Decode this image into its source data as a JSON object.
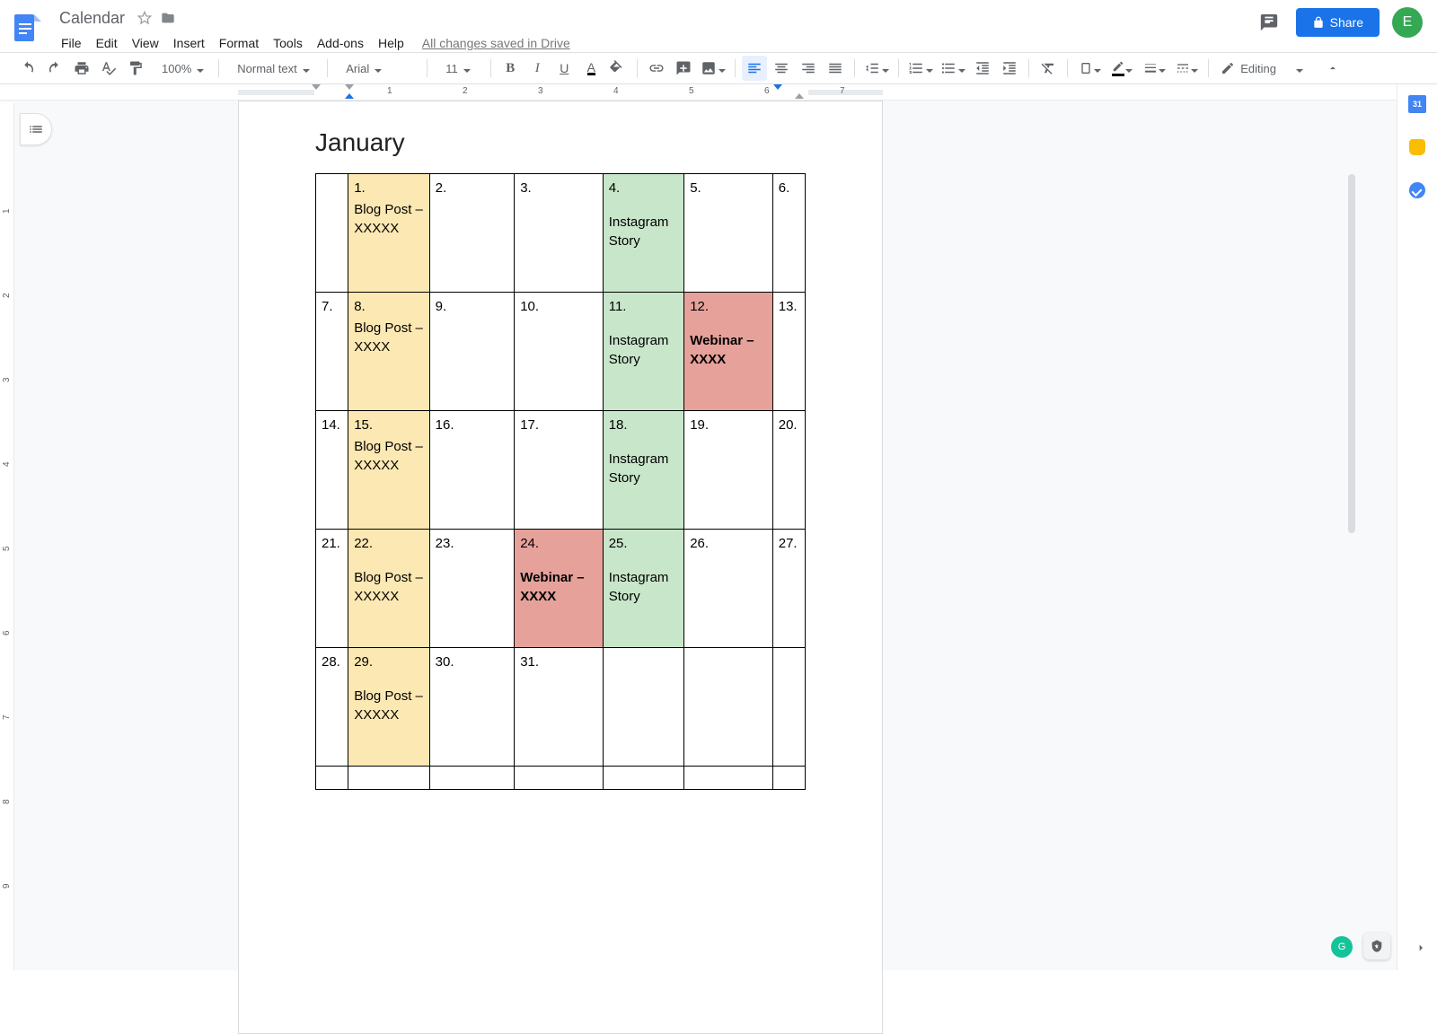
{
  "doc": {
    "title": "Calendar",
    "save_status": "All changes saved in Drive"
  },
  "avatar": {
    "initial": "E"
  },
  "menu": [
    "File",
    "Edit",
    "View",
    "Insert",
    "Format",
    "Tools",
    "Add-ons",
    "Help"
  ],
  "toolbar": {
    "zoom": "100%",
    "style": "Normal text",
    "font": "Arial",
    "size": "11",
    "mode": "Editing"
  },
  "share": {
    "label": "Share"
  },
  "side_calendar_day": "31",
  "hruler_ticks": [
    "1",
    "2",
    "3",
    "4",
    "5",
    "6",
    "7"
  ],
  "document": {
    "heading": "January",
    "rows": [
      [
        {
          "num": "",
          "body": "",
          "bg": ""
        },
        {
          "num": "1.",
          "body": "Blog Post  – XXXXX",
          "bg": "yellow"
        },
        {
          "num": "2.",
          "body": "",
          "bg": ""
        },
        {
          "num": "3.",
          "body": "",
          "bg": ""
        },
        {
          "num": "4.",
          "body": "Instagram Story",
          "bg": "green",
          "gap": true
        },
        {
          "num": "5.",
          "body": "",
          "bg": ""
        },
        {
          "num": "6.",
          "body": "",
          "bg": ""
        }
      ],
      [
        {
          "num": "7.",
          "body": "",
          "bg": ""
        },
        {
          "num": "8.",
          "body": "Blog Post – XXXX",
          "bg": "yellow"
        },
        {
          "num": "9.",
          "body": "",
          "bg": ""
        },
        {
          "num": "10.",
          "body": "",
          "bg": ""
        },
        {
          "num": "11.",
          "body": "Instagram Story",
          "bg": "green",
          "gap": true
        },
        {
          "num": "12.",
          "body": "Webinar – XXXX",
          "bg": "red",
          "gap": true,
          "bold": true
        },
        {
          "num": "13.",
          "body": "",
          "bg": ""
        }
      ],
      [
        {
          "num": "14.",
          "body": "",
          "bg": ""
        },
        {
          "num": "15.",
          "body": "Blog Post  – XXXXX",
          "bg": "yellow"
        },
        {
          "num": "16.",
          "body": "",
          "bg": ""
        },
        {
          "num": "17.",
          "body": "",
          "bg": ""
        },
        {
          "num": "18.",
          "body": "Instagram Story",
          "bg": "green",
          "gap": true
        },
        {
          "num": "19.",
          "body": "",
          "bg": ""
        },
        {
          "num": "20.",
          "body": "",
          "bg": ""
        }
      ],
      [
        {
          "num": "21.",
          "body": "",
          "bg": ""
        },
        {
          "num": "22.",
          "body": "Blog Post  – XXXXX",
          "bg": "yellow",
          "gap": true
        },
        {
          "num": "23.",
          "body": "",
          "bg": ""
        },
        {
          "num": "24.",
          "body": "Webinar – XXXX",
          "bg": "red",
          "gap": true,
          "bold": true
        },
        {
          "num": "25.",
          "body": "Instagram Story",
          "bg": "green",
          "gap": true
        },
        {
          "num": "26.",
          "body": "",
          "bg": ""
        },
        {
          "num": "27.",
          "body": "",
          "bg": ""
        }
      ],
      [
        {
          "num": "28.",
          "body": "",
          "bg": ""
        },
        {
          "num": "29.",
          "body": "Blog Post  – XXXXX",
          "bg": "yellow",
          "gap": true
        },
        {
          "num": "30.",
          "body": "",
          "bg": ""
        },
        {
          "num": "31.",
          "body": "",
          "bg": ""
        },
        {
          "num": "",
          "body": "",
          "bg": ""
        },
        {
          "num": "",
          "body": "",
          "bg": ""
        },
        {
          "num": "",
          "body": "",
          "bg": ""
        }
      ],
      [
        {
          "num": "",
          "body": "",
          "bg": ""
        },
        {
          "num": "",
          "body": "",
          "bg": ""
        },
        {
          "num": "",
          "body": "",
          "bg": ""
        },
        {
          "num": "",
          "body": "",
          "bg": ""
        },
        {
          "num": "",
          "body": "",
          "bg": ""
        },
        {
          "num": "",
          "body": "",
          "bg": ""
        },
        {
          "num": "",
          "body": "",
          "bg": ""
        }
      ]
    ]
  }
}
